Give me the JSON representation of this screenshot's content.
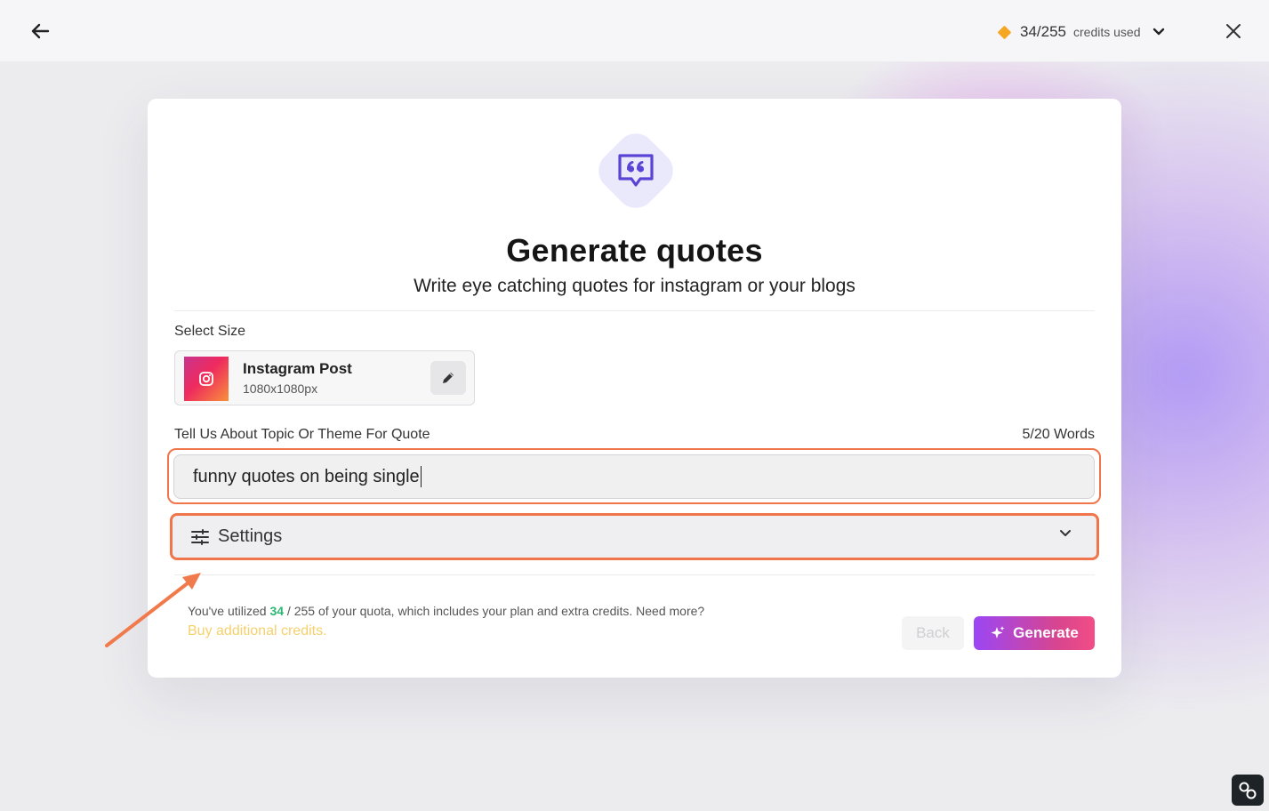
{
  "topbar": {
    "credits_used": "34/255",
    "credits_label": "credits used"
  },
  "dialog": {
    "title": "Generate quotes",
    "subtitle": "Write eye catching quotes for instagram or your blogs",
    "select_size_label": "Select Size",
    "size": {
      "name": "Instagram Post",
      "dimensions": "1080x1080px"
    },
    "topic_label": "Tell Us About Topic Or Theme For Quote",
    "word_count": "5/20 Words",
    "topic_value": "funny quotes on being single",
    "settings_label": "Settings",
    "quota": {
      "prefix": "You've utilized",
      "used": "34",
      "separator": "/",
      "total": "255",
      "suffix": "of your quota, which includes your plan and extra credits. Need more?"
    },
    "buy_link": "Buy additional credits.",
    "back_label": "Back",
    "generate_label": "Generate"
  },
  "colors": {
    "accent_orange": "#f0754a",
    "credit_diamond": "#f5a623",
    "quota_green": "#2bb673",
    "buy_link": "#f5d06c",
    "generate_gradient_start": "#9b46f5",
    "generate_gradient_end": "#f24d87",
    "icon_purple": "#5b43d6"
  },
  "icons": {
    "back": "arrow-left-icon",
    "credits": "diamond-icon",
    "dropdown": "chevron-down-icon",
    "close": "close-icon",
    "hero": "quote-bubble-icon",
    "size": "instagram-icon",
    "edit": "pencil-icon",
    "settings": "sliders-icon",
    "generate": "sparkle-icon",
    "corner": "link-icon"
  }
}
